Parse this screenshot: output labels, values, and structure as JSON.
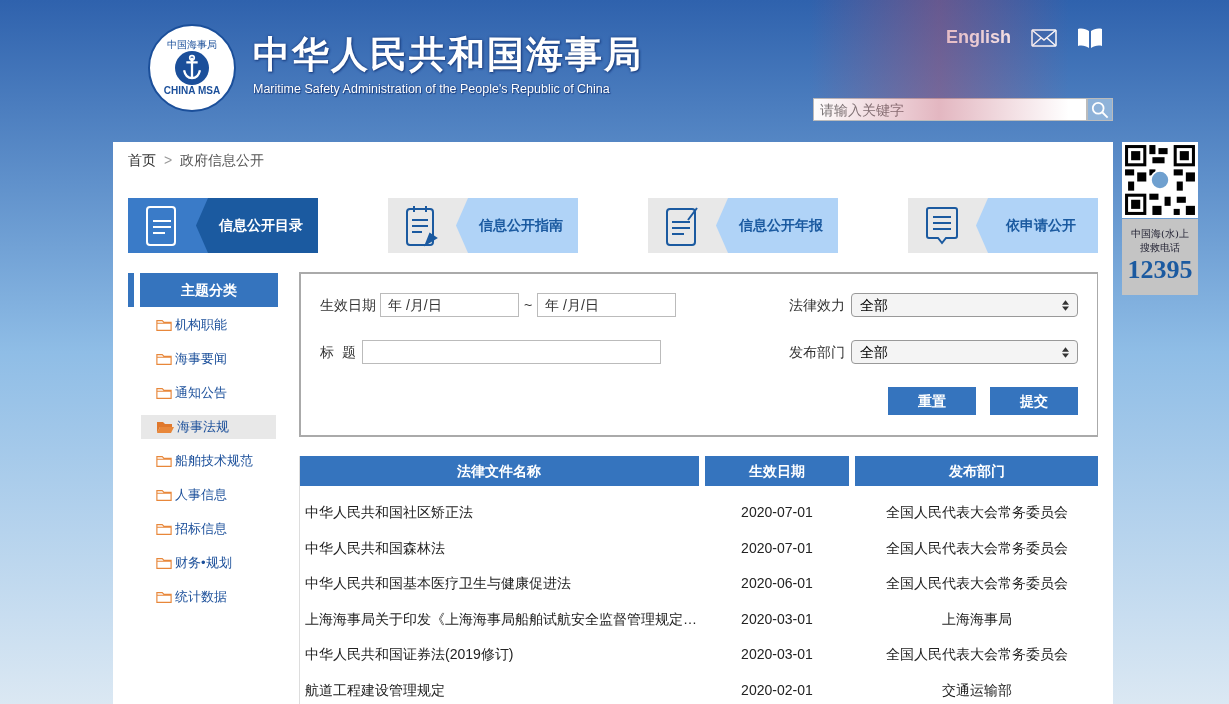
{
  "header": {
    "seal_top": "中国海事局",
    "seal_bottom": "CHINA MSA",
    "title": "中华人民共和国海事局",
    "subtitle": "Maritime Safety Administration of the People's Republic of China",
    "language_link": "English",
    "search": {
      "placeholder": "请输入关键字"
    }
  },
  "breadcrumb": {
    "items": [
      "首页",
      "政府信息公开"
    ],
    "separator": ">"
  },
  "nav_tabs": [
    {
      "label": "信息公开目录",
      "kind": "catalog",
      "selected": true
    },
    {
      "label": "信息公开指南",
      "kind": "guide",
      "selected": false
    },
    {
      "label": "信息公开年报",
      "kind": "report",
      "selected": false
    },
    {
      "label": "依申请公开",
      "kind": "request",
      "selected": false
    }
  ],
  "sidebar": {
    "title": "主题分类",
    "items": [
      {
        "label": "机构职能",
        "selected": false
      },
      {
        "label": "海事要闻",
        "selected": false
      },
      {
        "label": "通知公告",
        "selected": false
      },
      {
        "label": "海事法规",
        "selected": true
      },
      {
        "label": "船舶技术规范",
        "selected": false
      },
      {
        "label": "人事信息",
        "selected": false
      },
      {
        "label": "招标信息",
        "selected": false
      },
      {
        "label": "财务•规划",
        "selected": false
      },
      {
        "label": "统计数据",
        "selected": false
      }
    ]
  },
  "filter": {
    "date_label": "生效日期",
    "date_from": {
      "placeholder": "年 /月/日"
    },
    "date_separator": "~",
    "date_to": {
      "placeholder": "年 /月/日"
    },
    "title_label": "标  题",
    "effect_label": "法律效力",
    "effect_value": "全部",
    "dept_label": "发布部门",
    "dept_value": "全部",
    "buttons": [
      "重置",
      "提交"
    ]
  },
  "table": {
    "columns": [
      "法律文件名称",
      "生效日期",
      "发布部门"
    ],
    "rows": [
      [
        "中华人民共和国社区矫正法",
        "2020-07-01",
        "全国人民代表大会常务委员会"
      ],
      [
        "中华人民共和国森林法",
        "2020-07-01",
        "全国人民代表大会常务委员会"
      ],
      [
        "中华人民共和国基本医疗卫生与健康促进法",
        "2020-06-01",
        "全国人民代表大会常务委员会"
      ],
      [
        "上海海事局关于印发《上海海事局船舶试航安全监督管理规定…",
        "2020-03-01",
        "上海海事局"
      ],
      [
        "中华人民共和国证券法(2019修订)",
        "2020-03-01",
        "全国人民代表大会常务委员会"
      ],
      [
        "航道工程建设管理规定",
        "2020-02-01",
        "交通运输部"
      ]
    ]
  },
  "hotline": {
    "lines": [
      "中国海(水)上",
      "搜救电话"
    ],
    "number": "12395"
  }
}
